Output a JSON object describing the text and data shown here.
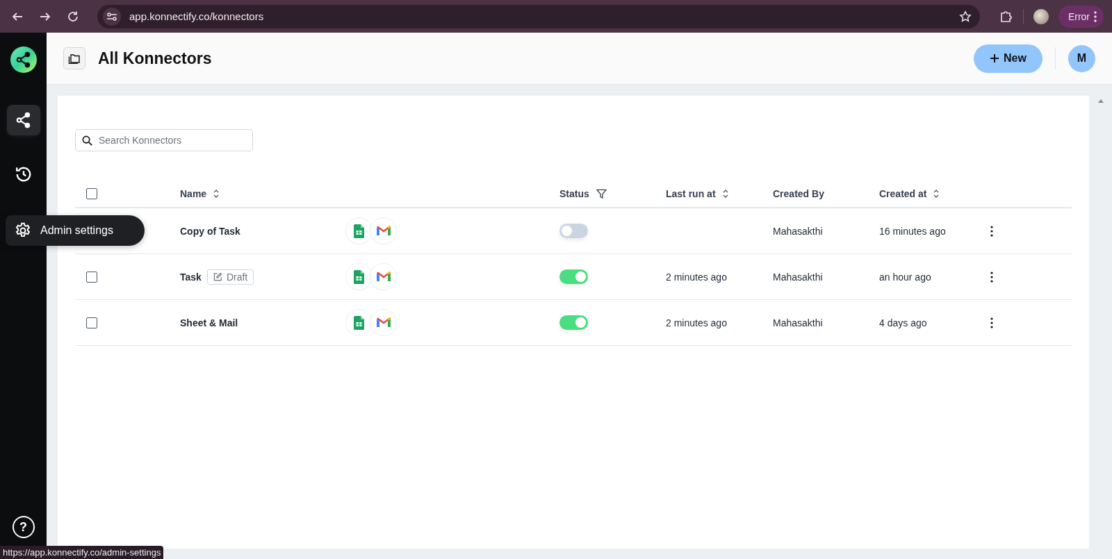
{
  "browser": {
    "url": "app.konnectify.co/konnectors",
    "profile_button": "Error"
  },
  "sidebar": {
    "items": [
      {
        "kind": "share",
        "selected": true
      },
      {
        "kind": "history",
        "selected": false
      },
      {
        "kind": "settings",
        "selected": false,
        "tooltip": "Admin settings"
      }
    ],
    "help": "?"
  },
  "header": {
    "title": "All Konnectors",
    "new_button": "New",
    "avatar": "M"
  },
  "search": {
    "placeholder": "Search Konnectors"
  },
  "table": {
    "columns": [
      {
        "label": "Name",
        "kind": "sort"
      },
      {
        "label": "Status",
        "kind": "filter"
      },
      {
        "label": "Last run at",
        "kind": "sort"
      },
      {
        "label": "Created By",
        "kind": "plain"
      },
      {
        "label": "Created at",
        "kind": "sort"
      }
    ],
    "header_checked": false,
    "rows": [
      {
        "name": "Copy of Task",
        "apps": [
          {
            "kind": "sheets"
          },
          {
            "kind": "gmail"
          }
        ],
        "on": false,
        "created_by": "Mahasakthi",
        "created_at": "16 minutes ago"
      },
      {
        "checked": false,
        "name": "Task",
        "badge": "Draft",
        "apps": [
          {
            "kind": "sheets"
          },
          {
            "kind": "gmail"
          }
        ],
        "on": true,
        "last_run": "2 minutes ago",
        "created_by": "Mahasakthi",
        "created_at": "an hour ago"
      },
      {
        "checked": false,
        "name": "Sheet & Mail",
        "apps": [
          {
            "kind": "sheets"
          },
          {
            "kind": "gmail"
          }
        ],
        "on": true,
        "last_run": "2 minutes ago",
        "created_by": "Mahasakthi",
        "created_at": "4 days ago"
      }
    ]
  },
  "status_bar": "https://app.konnectify.co/admin-settings"
}
